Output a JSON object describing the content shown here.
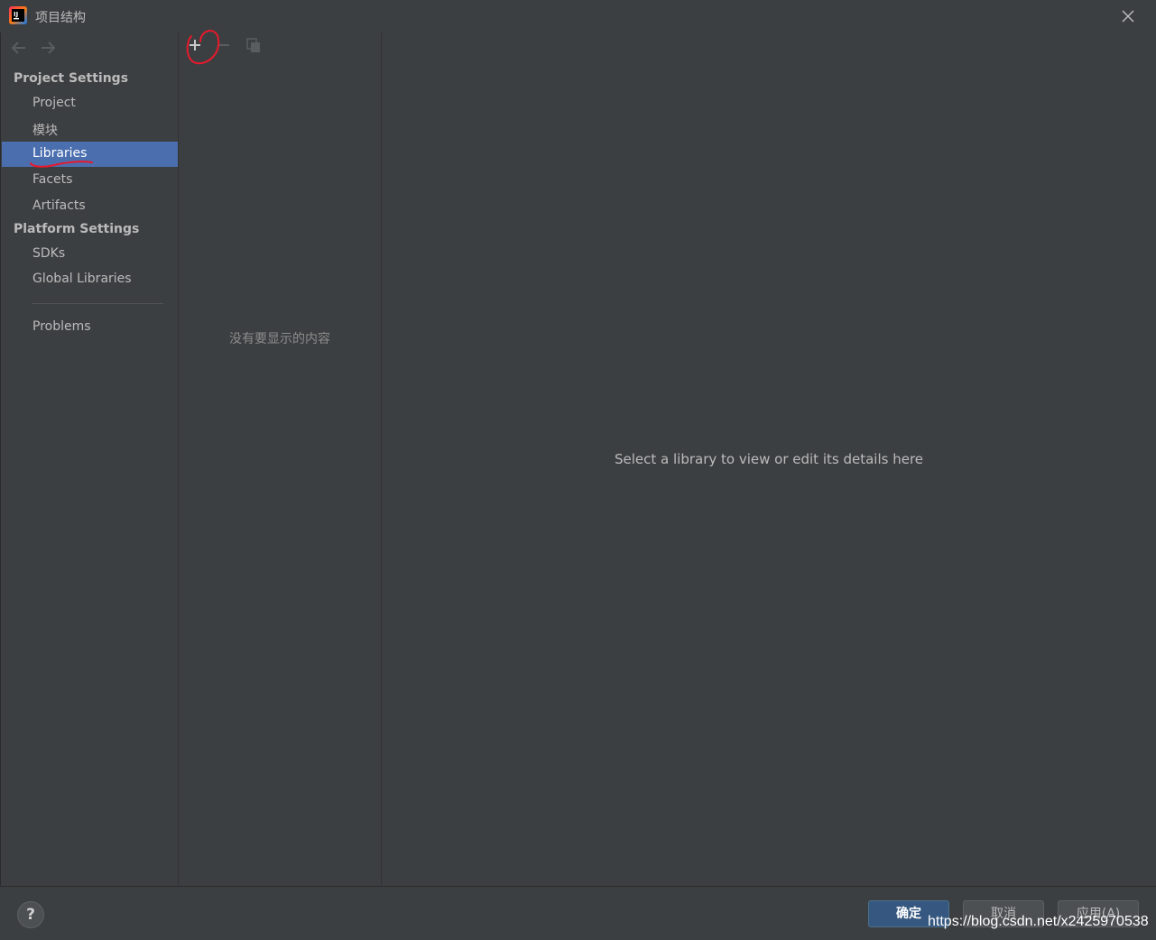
{
  "window": {
    "title": "项目结构",
    "icons": {
      "logo": "intellij-logo-icon",
      "close": "close-icon"
    }
  },
  "sidebar": {
    "nav": {
      "back_icon": "arrow-left-icon",
      "forward_icon": "arrow-right-icon"
    },
    "sections": [
      {
        "header": "Project Settings",
        "items": [
          "Project",
          "模块",
          "Libraries",
          "Facets",
          "Artifacts"
        ]
      },
      {
        "header": "Platform Settings",
        "items": [
          "SDKs",
          "Global Libraries"
        ]
      }
    ],
    "extra_items": [
      "Problems"
    ],
    "selected": "Libraries"
  },
  "list_panel": {
    "toolbar": {
      "add_icon": "plus-icon",
      "remove_icon": "minus-icon",
      "copy_icon": "copy-icon"
    },
    "empty_text": "没有要显示的内容"
  },
  "detail_panel": {
    "hint": "Select a library to view or edit its details here"
  },
  "buttons": {
    "help": "?",
    "ok": "确定",
    "cancel": "取消",
    "apply": "应用(A)"
  },
  "watermark": "https://blog.csdn.net/x2425970538",
  "colors": {
    "background": "#3c3f41",
    "selection": "#4b6eaf",
    "ok_button": "#365880",
    "annotation": "#e8192c"
  }
}
